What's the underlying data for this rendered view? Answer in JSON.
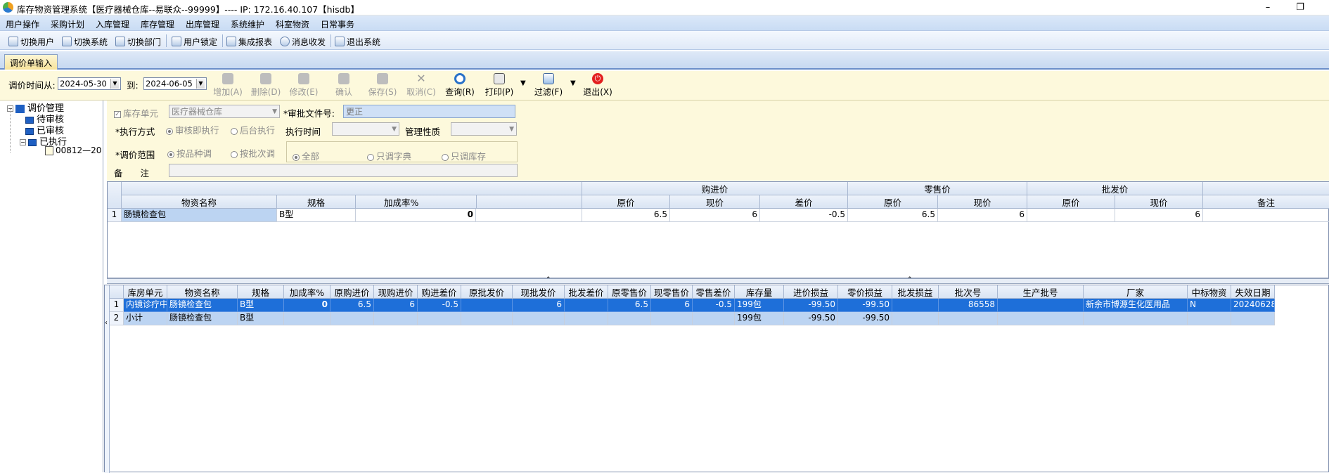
{
  "window": {
    "title": "库存物资管理系统【医疗器械仓库--易联众--99999】---- IP: 172.16.40.107【hisdb】",
    "minimize": "–",
    "restore": "❐"
  },
  "menu": [
    "用户操作",
    "采购计划",
    "入库管理",
    "库存管理",
    "出库管理",
    "系统维护",
    "科室物资",
    "日常事务"
  ],
  "toolbar": [
    "切换用户",
    "切换系统",
    "切换部门",
    "用户锁定",
    "集成报表",
    "消息收发",
    "退出系统"
  ],
  "tab": "调价单输入",
  "filter": {
    "from_label": "调价时间从:",
    "from_value": "2024-05-30",
    "to_label": "到:",
    "to_value": "2024-06-05"
  },
  "actions": {
    "add": "增加(A)",
    "delete": "删除(D)",
    "edit": "修改(E)",
    "confirm": "确认",
    "save": "保存(S)",
    "cancel": "取消(C)",
    "query": "查询(R)",
    "print": "打印(P)",
    "filter": "过滤(F)",
    "exit": "退出(X)"
  },
  "tree": {
    "root": "调价管理",
    "pending": "待审核",
    "reviewed": "已审核",
    "executed": "已执行",
    "doc": "00812—20"
  },
  "form": {
    "stock_unit_label": "库存单元",
    "stock_unit_value": "医疗器械仓库",
    "approval_label": "*审批文件号:",
    "approval_value": "更正",
    "exec_mode_label": "*执行方式",
    "exec_mode_opt1": "审核即执行",
    "exec_mode_opt2": "后台执行",
    "exec_time_label": "执行时间",
    "mgmt_label": "管理性质",
    "scope_label": "*调价范围",
    "scope_opt1": "按品种调",
    "scope_opt2": "按批次调",
    "scope2_opt1": "全部",
    "scope2_opt2": "只调字典",
    "scope2_opt3": "只调库存",
    "remark_label": "备　　注"
  },
  "grid1": {
    "groups": [
      "购进价",
      "零售价",
      "批发价"
    ],
    "headers": [
      "物资名称",
      "规格",
      "加成率%",
      "原价",
      "现价",
      "差价",
      "原价",
      "现价",
      "原价",
      "现价",
      "备注"
    ],
    "rows": [
      {
        "no": "1",
        "name": "肠镜检查包",
        "spec": "B型",
        "markup": "0",
        "buy_old": "6.5",
        "buy_new": "6",
        "buy_diff": "-0.5",
        "ret_old": "6.5",
        "ret_new": "6",
        "whl_old": "",
        "whl_new": "6",
        "remark": ""
      }
    ]
  },
  "grid2": {
    "headers": [
      "库房单元",
      "物资名称",
      "规格",
      "加成率%",
      "原购进价",
      "现购进价",
      "购进差价",
      "原批发价",
      "现批发价",
      "批发差价",
      "原零售价",
      "现零售价",
      "零售差价",
      "库存量",
      "进价损益",
      "零价损益",
      "批发损益",
      "批次号",
      "生产批号",
      "厂家",
      "中标物资",
      "失效日期"
    ],
    "rows": [
      {
        "no": "1",
        "unit": "内镜诊疗中",
        "name": "肠镜检查包",
        "spec": "B型",
        "markup": "0",
        "buy_old": "6.5",
        "buy_new": "6",
        "buy_diff": "-0.5",
        "whl_old": "",
        "whl_new": "6",
        "whl_diff": "",
        "ret_old": "6.5",
        "ret_new": "6",
        "ret_diff": "-0.5",
        "qty": "199包",
        "buy_pl": "-99.50",
        "ret_pl": "-99.50",
        "whl_pl": "",
        "batch": "86558",
        "lot": "",
        "maker": "新余市博源生化医用品",
        "bid": "N",
        "expiry": "20240628"
      },
      {
        "no": "2",
        "unit": "小计",
        "name": "肠镜检查包",
        "spec": "B型",
        "markup": "",
        "buy_old": "",
        "buy_new": "",
        "buy_diff": "",
        "whl_old": "",
        "whl_new": "",
        "whl_diff": "",
        "ret_old": "",
        "ret_new": "",
        "ret_diff": "",
        "qty": "199包",
        "buy_pl": "-99.50",
        "ret_pl": "-99.50",
        "whl_pl": "",
        "batch": "",
        "lot": "",
        "maker": "",
        "bid": "",
        "expiry": ""
      }
    ]
  }
}
